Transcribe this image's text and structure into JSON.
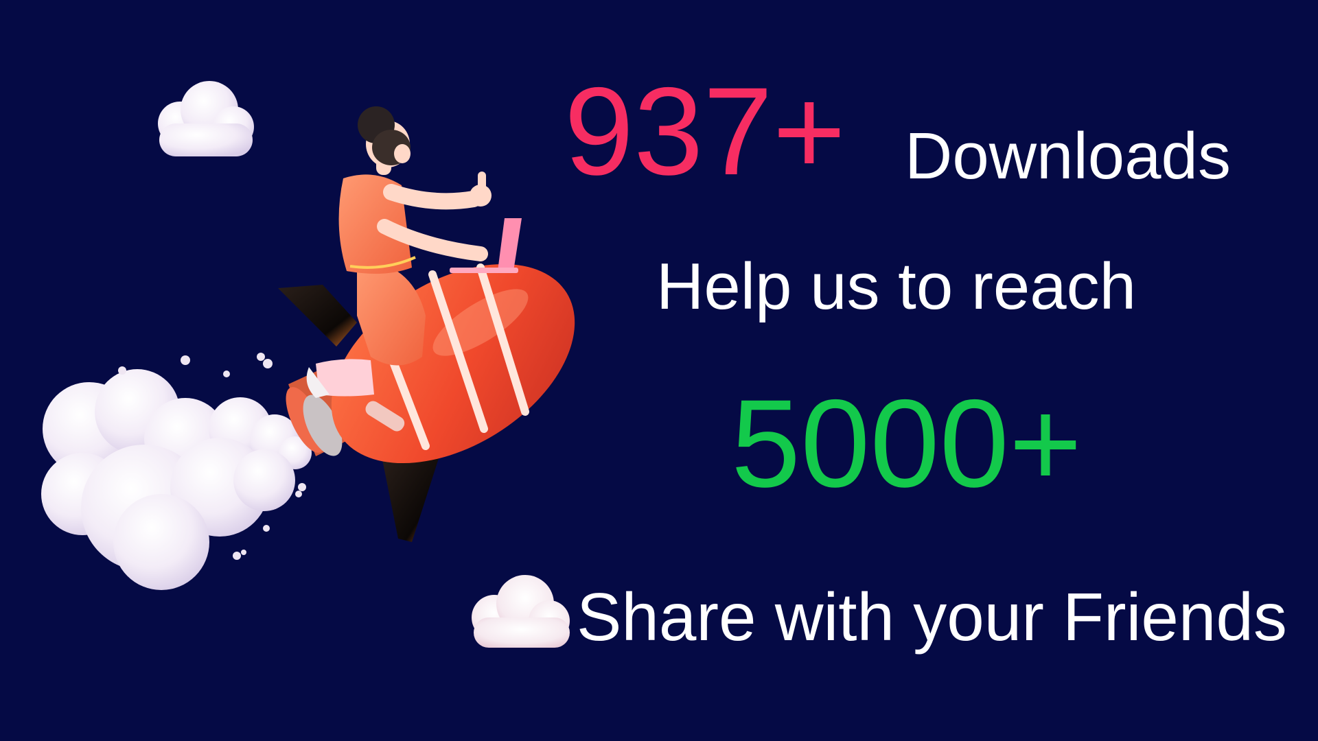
{
  "downloads": {
    "count": "937+",
    "label": "Downloads",
    "count_color": "#f72d62"
  },
  "cta": {
    "line1": "Help us to reach",
    "goal": "5000+",
    "goal_color": "#13c94b",
    "share": "Share with your Friends"
  },
  "colors": {
    "background": "#050a45",
    "text": "#ffffff"
  },
  "illustration": {
    "subject": "person-riding-rocket-icon",
    "elements": [
      "cloud-icon",
      "rocket-icon",
      "laptop-icon",
      "smoke-cloud-icon"
    ]
  }
}
